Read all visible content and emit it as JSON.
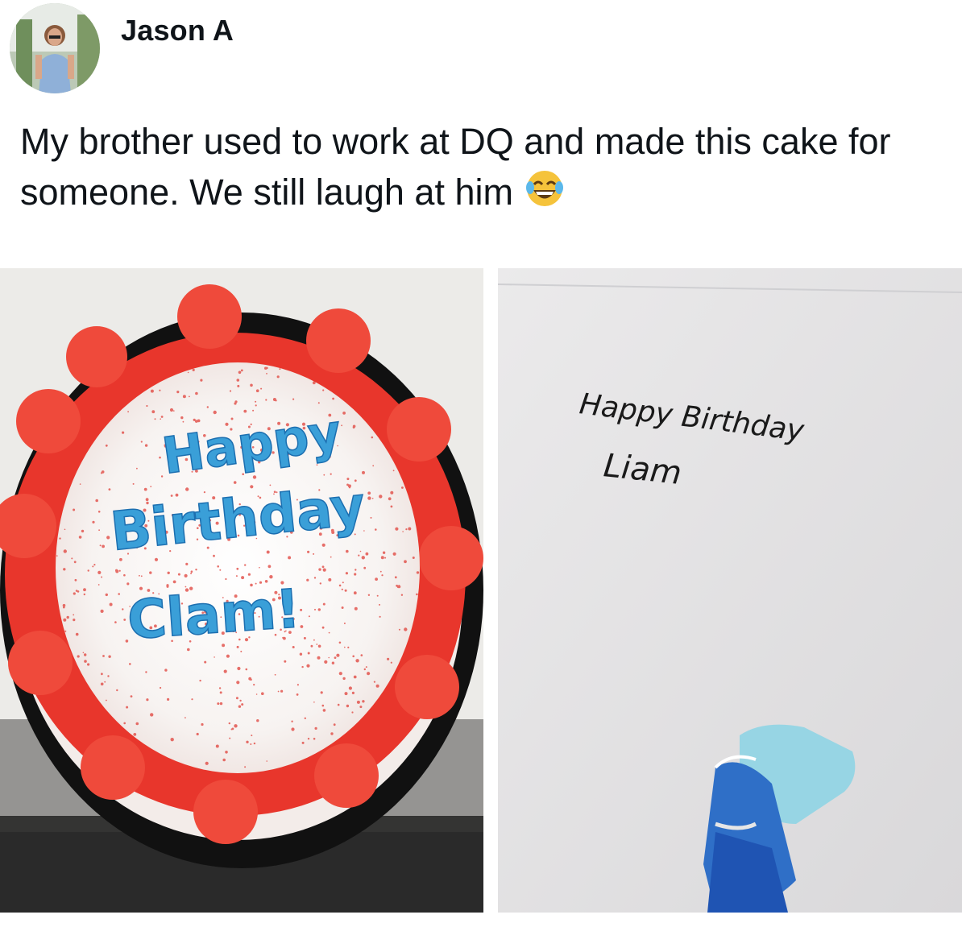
{
  "post": {
    "author": {
      "name": "Jason A",
      "avatar_icon": "profile-photo"
    },
    "text": "My brother used to work at DQ and made this cake for someone. We still laugh at him",
    "emoji": "laughing-crying-emoji"
  },
  "photos": {
    "cake": {
      "lines": [
        "Happy",
        "Birthday",
        "Clam!"
      ]
    },
    "note": {
      "lines": [
        "Happy Birthday",
        "Liam"
      ]
    }
  },
  "colors": {
    "frosting_red": "#e8362c",
    "writing_blue": "#3a9fd8",
    "text": "#0f1419"
  }
}
